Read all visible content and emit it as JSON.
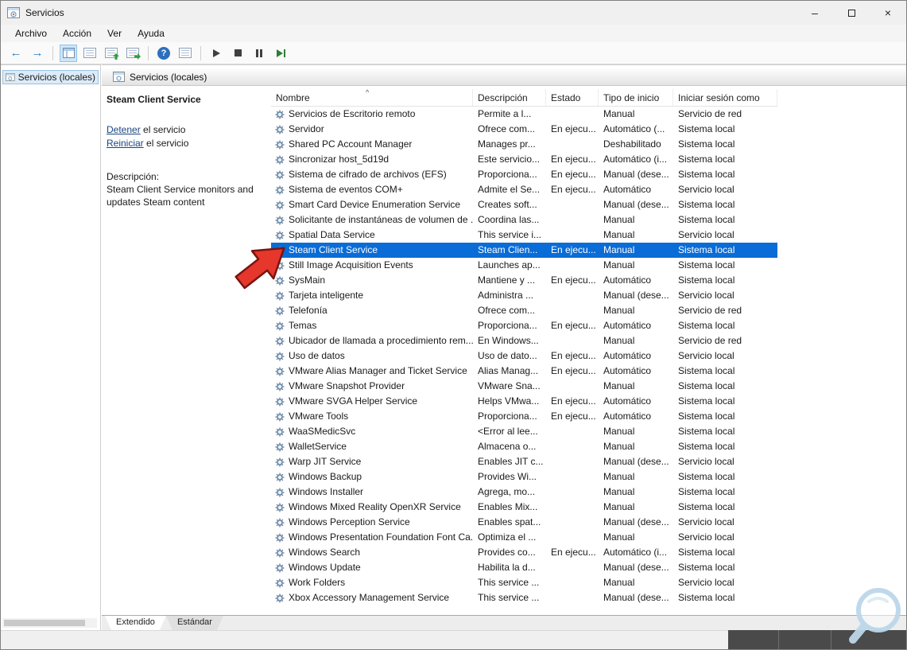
{
  "window": {
    "title": "Servicios"
  },
  "icons": {
    "minimize": "–",
    "close": "×",
    "back": "←",
    "forward": "→",
    "help": "?",
    "sort_indicator": "^"
  },
  "menu": {
    "items": [
      "Archivo",
      "Acción",
      "Ver",
      "Ayuda"
    ]
  },
  "tree": {
    "root_label": "Servicios (locales)"
  },
  "panel": {
    "header": "Servicios (locales)",
    "service_name": "Steam Client Service",
    "stop_link": "Detener",
    "stop_suffix": " el servicio",
    "restart_link": "Reiniciar",
    "restart_suffix": " el servicio",
    "description_label": "Descripción:",
    "description": "Steam Client Service monitors and updates Steam content"
  },
  "table": {
    "columns": [
      "Nombre",
      "Descripción",
      "Estado",
      "Tipo de inicio",
      "Iniciar sesión como"
    ],
    "rows": [
      {
        "n": "Servicios de Escritorio remoto",
        "d": "Permite a l...",
        "e": "",
        "t": "Manual",
        "s": "Servicio de red"
      },
      {
        "n": "Servidor",
        "d": "Ofrece com...",
        "e": "En ejecu...",
        "t": "Automático (...",
        "s": "Sistema local"
      },
      {
        "n": "Shared PC Account Manager",
        "d": "Manages pr...",
        "e": "",
        "t": "Deshabilitado",
        "s": "Sistema local"
      },
      {
        "n": "Sincronizar host_5d19d",
        "d": "Este servicio...",
        "e": "En ejecu...",
        "t": "Automático (i...",
        "s": "Sistema local"
      },
      {
        "n": "Sistema de cifrado de archivos (EFS)",
        "d": "Proporciona...",
        "e": "En ejecu...",
        "t": "Manual (dese...",
        "s": "Sistema local"
      },
      {
        "n": "Sistema de eventos COM+",
        "d": "Admite el Se...",
        "e": "En ejecu...",
        "t": "Automático",
        "s": "Servicio local"
      },
      {
        "n": "Smart Card Device Enumeration Service",
        "d": "Creates soft...",
        "e": "",
        "t": "Manual (dese...",
        "s": "Sistema local"
      },
      {
        "n": "Solicitante de instantáneas de volumen de ...",
        "d": "Coordina las...",
        "e": "",
        "t": "Manual",
        "s": "Sistema local"
      },
      {
        "n": "Spatial Data Service",
        "d": "This service i...",
        "e": "",
        "t": "Manual",
        "s": "Servicio local"
      },
      {
        "n": "Steam Client Service",
        "d": "Steam Clien...",
        "e": "En ejecu...",
        "t": "Manual",
        "s": "Sistema local",
        "sel": true
      },
      {
        "n": "Still Image Acquisition Events",
        "d": "Launches ap...",
        "e": "",
        "t": "Manual",
        "s": "Sistema local"
      },
      {
        "n": "SysMain",
        "d": "Mantiene y ...",
        "e": "En ejecu...",
        "t": "Automático",
        "s": "Sistema local"
      },
      {
        "n": "Tarjeta inteligente",
        "d": "Administra ...",
        "e": "",
        "t": "Manual (dese...",
        "s": "Servicio local"
      },
      {
        "n": "Telefonía",
        "d": "Ofrece com...",
        "e": "",
        "t": "Manual",
        "s": "Servicio de red"
      },
      {
        "n": "Temas",
        "d": "Proporciona...",
        "e": "En ejecu...",
        "t": "Automático",
        "s": "Sistema local"
      },
      {
        "n": "Ubicador de llamada a procedimiento rem...",
        "d": "En Windows...",
        "e": "",
        "t": "Manual",
        "s": "Servicio de red"
      },
      {
        "n": "Uso de datos",
        "d": "Uso de dato...",
        "e": "En ejecu...",
        "t": "Automático",
        "s": "Servicio local"
      },
      {
        "n": "VMware Alias Manager and Ticket Service",
        "d": "Alias Manag...",
        "e": "En ejecu...",
        "t": "Automático",
        "s": "Sistema local"
      },
      {
        "n": "VMware Snapshot Provider",
        "d": "VMware Sna...",
        "e": "",
        "t": "Manual",
        "s": "Sistema local"
      },
      {
        "n": "VMware SVGA Helper Service",
        "d": "Helps VMwa...",
        "e": "En ejecu...",
        "t": "Automático",
        "s": "Sistema local"
      },
      {
        "n": "VMware Tools",
        "d": "Proporciona...",
        "e": "En ejecu...",
        "t": "Automático",
        "s": "Sistema local"
      },
      {
        "n": "WaaSMedicSvc",
        "d": "<Error al lee...",
        "e": "",
        "t": "Manual",
        "s": "Sistema local"
      },
      {
        "n": "WalletService",
        "d": "Almacena o...",
        "e": "",
        "t": "Manual",
        "s": "Sistema local"
      },
      {
        "n": "Warp JIT Service",
        "d": "Enables JIT c...",
        "e": "",
        "t": "Manual (dese...",
        "s": "Servicio local"
      },
      {
        "n": "Windows Backup",
        "d": "Provides Wi...",
        "e": "",
        "t": "Manual",
        "s": "Sistema local"
      },
      {
        "n": "Windows Installer",
        "d": "Agrega, mo...",
        "e": "",
        "t": "Manual",
        "s": "Sistema local"
      },
      {
        "n": "Windows Mixed Reality OpenXR Service",
        "d": "Enables Mix...",
        "e": "",
        "t": "Manual",
        "s": "Sistema local"
      },
      {
        "n": "Windows Perception Service",
        "d": "Enables spat...",
        "e": "",
        "t": "Manual (dese...",
        "s": "Servicio local"
      },
      {
        "n": "Windows Presentation Foundation Font Ca...",
        "d": "Optimiza el ...",
        "e": "",
        "t": "Manual",
        "s": "Servicio local"
      },
      {
        "n": "Windows Search",
        "d": "Provides co...",
        "e": "En ejecu...",
        "t": "Automático (i...",
        "s": "Sistema local"
      },
      {
        "n": "Windows Update",
        "d": "Habilita la d...",
        "e": "",
        "t": "Manual (dese...",
        "s": "Sistema local"
      },
      {
        "n": "Work Folders",
        "d": "This service ...",
        "e": "",
        "t": "Manual",
        "s": "Servicio local"
      },
      {
        "n": "Xbox Accessory Management Service",
        "d": "This service ...",
        "e": "",
        "t": "Manual (dese...",
        "s": "Sistema local"
      }
    ]
  },
  "tabs": {
    "extended": "Extendido",
    "standard": "Estándar"
  },
  "colors": {
    "selection_blue": "#0a6cd6",
    "link_blue": "#1a4480",
    "arrow_red": "#e5372b",
    "watermark_blue": "#bcd7ea",
    "dark_bar": "#4a4a4a"
  }
}
